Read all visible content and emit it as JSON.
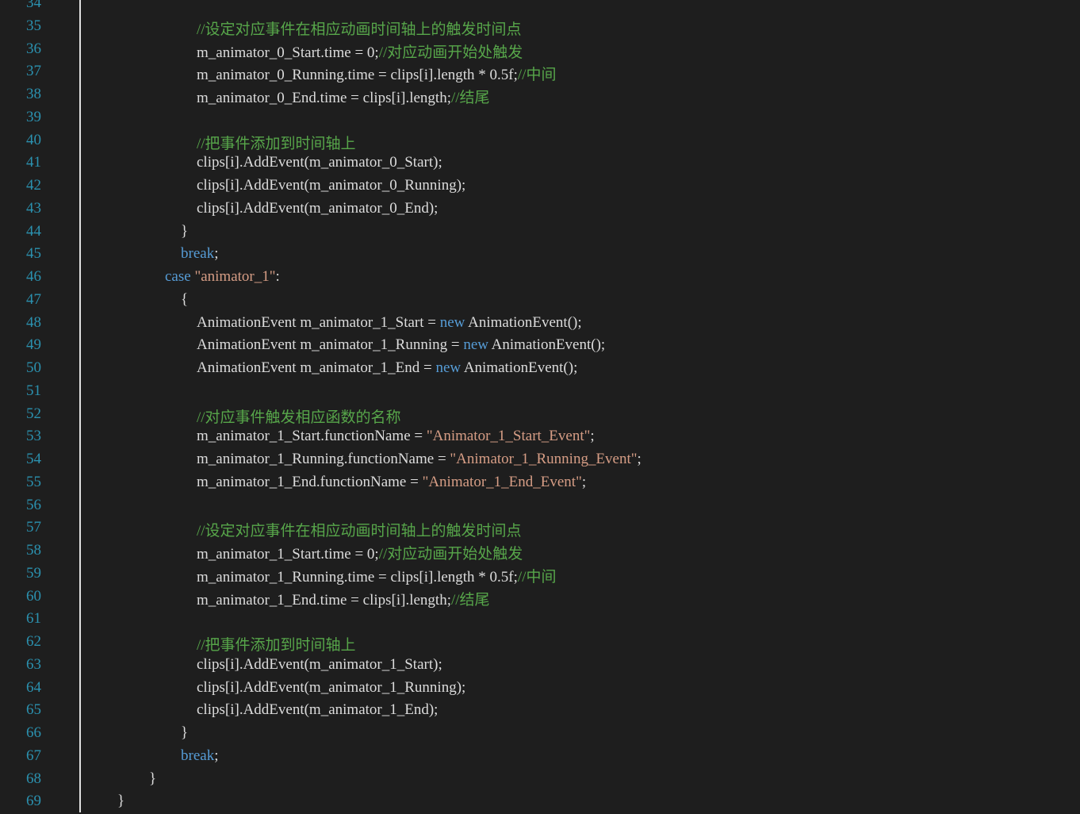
{
  "editor": {
    "lines": [
      {
        "num": "34",
        "indent": 0,
        "tokens": []
      },
      {
        "num": "35",
        "indent": 5,
        "tokens": [
          {
            "t": "cm",
            "v": "//设定对应事件在相应动画时间轴上的触发时间点"
          }
        ]
      },
      {
        "num": "36",
        "indent": 5,
        "tokens": [
          {
            "t": "tx",
            "v": "m_animator_0_Start.time = 0;"
          },
          {
            "t": "cm",
            "v": "//对应动画开始处触发"
          }
        ]
      },
      {
        "num": "37",
        "indent": 5,
        "tokens": [
          {
            "t": "tx",
            "v": "m_animator_0_Running.time = clips[i].length * 0.5f;"
          },
          {
            "t": "cm",
            "v": "//中间"
          }
        ]
      },
      {
        "num": "38",
        "indent": 5,
        "tokens": [
          {
            "t": "tx",
            "v": "m_animator_0_End.time = clips[i].length;"
          },
          {
            "t": "cm",
            "v": "//结尾"
          }
        ]
      },
      {
        "num": "39",
        "indent": 0,
        "tokens": []
      },
      {
        "num": "40",
        "indent": 5,
        "tokens": [
          {
            "t": "cm",
            "v": "//把事件添加到时间轴上"
          }
        ]
      },
      {
        "num": "41",
        "indent": 5,
        "tokens": [
          {
            "t": "tx",
            "v": "clips[i].AddEvent(m_animator_0_Start);"
          }
        ]
      },
      {
        "num": "42",
        "indent": 5,
        "tokens": [
          {
            "t": "tx",
            "v": "clips[i].AddEvent(m_animator_0_Running);"
          }
        ]
      },
      {
        "num": "43",
        "indent": 5,
        "tokens": [
          {
            "t": "tx",
            "v": "clips[i].AddEvent(m_animator_0_End);"
          }
        ]
      },
      {
        "num": "44",
        "indent": 4,
        "tokens": [
          {
            "t": "tx",
            "v": "}"
          }
        ]
      },
      {
        "num": "45",
        "indent": 4,
        "tokens": [
          {
            "t": "kw",
            "v": "break"
          },
          {
            "t": "tx",
            "v": ";"
          }
        ]
      },
      {
        "num": "46",
        "indent": 3,
        "tokens": [
          {
            "t": "kw",
            "v": "case "
          },
          {
            "t": "str",
            "v": "\"animator_1\""
          },
          {
            "t": "tx",
            "v": ":"
          }
        ]
      },
      {
        "num": "47",
        "indent": 4,
        "tokens": [
          {
            "t": "tx",
            "v": "{"
          }
        ]
      },
      {
        "num": "48",
        "indent": 5,
        "tokens": [
          {
            "t": "tx",
            "v": "AnimationEvent m_animator_1_Start = "
          },
          {
            "t": "kw",
            "v": "new"
          },
          {
            "t": "tx",
            "v": " AnimationEvent();"
          }
        ]
      },
      {
        "num": "49",
        "indent": 5,
        "tokens": [
          {
            "t": "tx",
            "v": "AnimationEvent m_animator_1_Running = "
          },
          {
            "t": "kw",
            "v": "new"
          },
          {
            "t": "tx",
            "v": " AnimationEvent();"
          }
        ]
      },
      {
        "num": "50",
        "indent": 5,
        "tokens": [
          {
            "t": "tx",
            "v": "AnimationEvent m_animator_1_End = "
          },
          {
            "t": "kw",
            "v": "new"
          },
          {
            "t": "tx",
            "v": " AnimationEvent();"
          }
        ]
      },
      {
        "num": "51",
        "indent": 0,
        "tokens": []
      },
      {
        "num": "52",
        "indent": 5,
        "tokens": [
          {
            "t": "cm",
            "v": "//对应事件触发相应函数的名称"
          }
        ]
      },
      {
        "num": "53",
        "indent": 5,
        "tokens": [
          {
            "t": "tx",
            "v": "m_animator_1_Start.functionName = "
          },
          {
            "t": "str",
            "v": "\"Animator_1_Start_Event\""
          },
          {
            "t": "tx",
            "v": ";"
          }
        ]
      },
      {
        "num": "54",
        "indent": 5,
        "tokens": [
          {
            "t": "tx",
            "v": "m_animator_1_Running.functionName = "
          },
          {
            "t": "str",
            "v": "\"Animator_1_Running_Event\""
          },
          {
            "t": "tx",
            "v": ";"
          }
        ]
      },
      {
        "num": "55",
        "indent": 5,
        "tokens": [
          {
            "t": "tx",
            "v": "m_animator_1_End.functionName = "
          },
          {
            "t": "str",
            "v": "\"Animator_1_End_Event\""
          },
          {
            "t": "tx",
            "v": ";"
          }
        ]
      },
      {
        "num": "56",
        "indent": 0,
        "tokens": []
      },
      {
        "num": "57",
        "indent": 5,
        "tokens": [
          {
            "t": "cm",
            "v": "//设定对应事件在相应动画时间轴上的触发时间点"
          }
        ]
      },
      {
        "num": "58",
        "indent": 5,
        "tokens": [
          {
            "t": "tx",
            "v": "m_animator_1_Start.time = 0;"
          },
          {
            "t": "cm",
            "v": "//对应动画开始处触发"
          }
        ]
      },
      {
        "num": "59",
        "indent": 5,
        "tokens": [
          {
            "t": "tx",
            "v": "m_animator_1_Running.time = clips[i].length * 0.5f;"
          },
          {
            "t": "cm",
            "v": "//中间"
          }
        ]
      },
      {
        "num": "60",
        "indent": 5,
        "tokens": [
          {
            "t": "tx",
            "v": "m_animator_1_End.time = clips[i].length;"
          },
          {
            "t": "cm",
            "v": "//结尾"
          }
        ]
      },
      {
        "num": "61",
        "indent": 0,
        "tokens": []
      },
      {
        "num": "62",
        "indent": 5,
        "tokens": [
          {
            "t": "cm",
            "v": "//把事件添加到时间轴上"
          }
        ]
      },
      {
        "num": "63",
        "indent": 5,
        "tokens": [
          {
            "t": "tx",
            "v": "clips[i].AddEvent(m_animator_1_Start);"
          }
        ]
      },
      {
        "num": "64",
        "indent": 5,
        "tokens": [
          {
            "t": "tx",
            "v": "clips[i].AddEvent(m_animator_1_Running);"
          }
        ]
      },
      {
        "num": "65",
        "indent": 5,
        "tokens": [
          {
            "t": "tx",
            "v": "clips[i].AddEvent(m_animator_1_End);"
          }
        ]
      },
      {
        "num": "66",
        "indent": 4,
        "tokens": [
          {
            "t": "tx",
            "v": "}"
          }
        ]
      },
      {
        "num": "67",
        "indent": 4,
        "tokens": [
          {
            "t": "kw",
            "v": "break"
          },
          {
            "t": "tx",
            "v": ";"
          }
        ]
      },
      {
        "num": "68",
        "indent": 2,
        "tokens": [
          {
            "t": "tx",
            "v": "}"
          }
        ]
      },
      {
        "num": "69",
        "indent": 1,
        "tokens": [
          {
            "t": "tx",
            "v": "}"
          }
        ]
      }
    ]
  },
  "colors": {
    "background": "#1e1e1e",
    "line_number": "#2b91af",
    "keyword": "#569cd6",
    "string": "#d69d85",
    "comment": "#57a64a",
    "text": "#dcdcdc"
  }
}
